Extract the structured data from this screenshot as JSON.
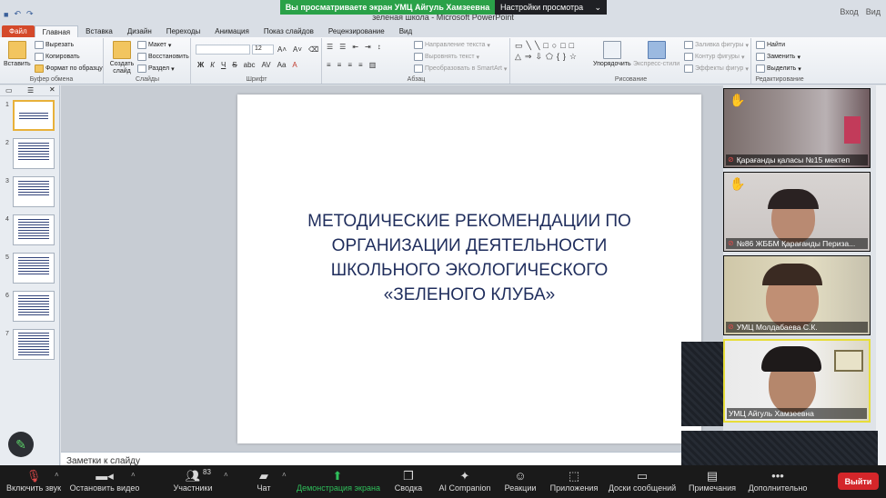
{
  "window": {
    "title": "зеленая школа  -  Microsoft PowerPoint",
    "right_buttons": [
      "Вход",
      "Вид"
    ]
  },
  "share_banner": {
    "message": "Вы просматриваете экран УМЦ Айгуль Хамзеевна",
    "options": "Настройки просмотра",
    "banner_color": "#2aa148"
  },
  "ribbon": {
    "tabs": [
      "Файл",
      "Главная",
      "Вставка",
      "Дизайн",
      "Переходы",
      "Анимация",
      "Показ слайдов",
      "Рецензирование",
      "Вид"
    ],
    "active_tab": "Главная",
    "clipboard": {
      "label": "Буфер обмена",
      "paste": "Вставить",
      "cut": "Вырезать",
      "copy": "Копировать",
      "format_painter": "Формат по образцу"
    },
    "slides": {
      "label": "Слайды",
      "new_slide": "Создать слайд",
      "layout": "Макет",
      "reset": "Восстановить",
      "section": "Раздел"
    },
    "font": {
      "label": "Шрифт",
      "size": "12"
    },
    "paragraph": {
      "label": "Абзац",
      "text_direction": "Направление текста",
      "align_text": "Выровнять текст",
      "smartart": "Преобразовать в SmartArt"
    },
    "drawing": {
      "label": "Рисование",
      "arrange": "Упорядочить",
      "quick_styles": "Экспресс-стили",
      "shape_fill": "Заливка фигуры",
      "shape_outline": "Контур фигуры",
      "shape_effects": "Эффекты фигур"
    },
    "editing": {
      "label": "Редактирование",
      "find": "Найти",
      "replace": "Заменить",
      "select": "Выделить"
    }
  },
  "slides": {
    "numbers": [
      "1",
      "2",
      "3",
      "4",
      "5",
      "6",
      "7"
    ],
    "selected": 1
  },
  "slide": {
    "title": "МЕТОДИЧЕСКИЕ РЕКОМЕНДАЦИИ ПО\nОРГАНИЗАЦИИ ДЕЯТЕЛЬНОСТИ\nШКОЛЬНОГО ЭКОЛОГИЧЕСКОГО\n«ЗЕЛЕНОГО КЛУБА»",
    "title_color": "#1f2d5c"
  },
  "notes_placeholder": "Заметки к слайду",
  "participants_videos": [
    {
      "name": "Қарағанды қаласы №15 мектеп",
      "hand_raised": true,
      "muted": true
    },
    {
      "name": "№86 ЖББМ Қарағанды Периза...",
      "hand_raised": true,
      "muted": true
    },
    {
      "name": "УМЦ Молдабаева С.К.",
      "hand_raised": false,
      "muted": true
    },
    {
      "name": "УМЦ Айгуль Хамзеевна",
      "hand_raised": false,
      "muted": false,
      "active_speaker": true
    }
  ],
  "zoom_toolbar": {
    "mute": "Включить звук",
    "video": "Остановить видео",
    "participants": "Участники",
    "participants_count": "83",
    "chat": "Чат",
    "share": "Демонстрация экрана",
    "polls": "Сводка",
    "ai": "AI Companion",
    "reactions": "Реакции",
    "apps": "Приложения",
    "whiteboards": "Доски сообщений",
    "notes": "Примечания",
    "more": "Дополнительно",
    "leave": "Выйти",
    "leave_color": "#d4262a",
    "share_color": "#2fbf5b"
  }
}
